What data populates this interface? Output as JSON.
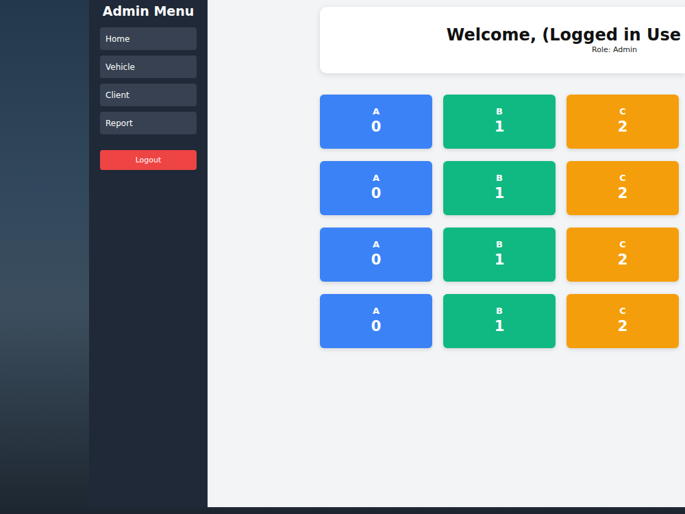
{
  "sidebar": {
    "title": "Admin Menu",
    "items": [
      {
        "label": "Home"
      },
      {
        "label": "Vehicle"
      },
      {
        "label": "Client"
      },
      {
        "label": "Report"
      }
    ],
    "logout": "Logout"
  },
  "header": {
    "title": "Welcome, (Logged in Use",
    "role": "Role: Admin"
  },
  "stats": [
    {
      "label": "A",
      "value": "0",
      "color": "#3b82f6"
    },
    {
      "label": "B",
      "value": "1",
      "color": "#10b981"
    },
    {
      "label": "C",
      "value": "2",
      "color": "#f59e0b"
    },
    {
      "label": "A",
      "value": "0",
      "color": "#3b82f6"
    },
    {
      "label": "B",
      "value": "1",
      "color": "#10b981"
    },
    {
      "label": "C",
      "value": "2",
      "color": "#f59e0b"
    },
    {
      "label": "A",
      "value": "0",
      "color": "#3b82f6"
    },
    {
      "label": "B",
      "value": "1",
      "color": "#10b981"
    },
    {
      "label": "C",
      "value": "2",
      "color": "#f59e0b"
    },
    {
      "label": "A",
      "value": "0",
      "color": "#3b82f6"
    },
    {
      "label": "B",
      "value": "1",
      "color": "#10b981"
    },
    {
      "label": "C",
      "value": "2",
      "color": "#f59e0b"
    }
  ]
}
